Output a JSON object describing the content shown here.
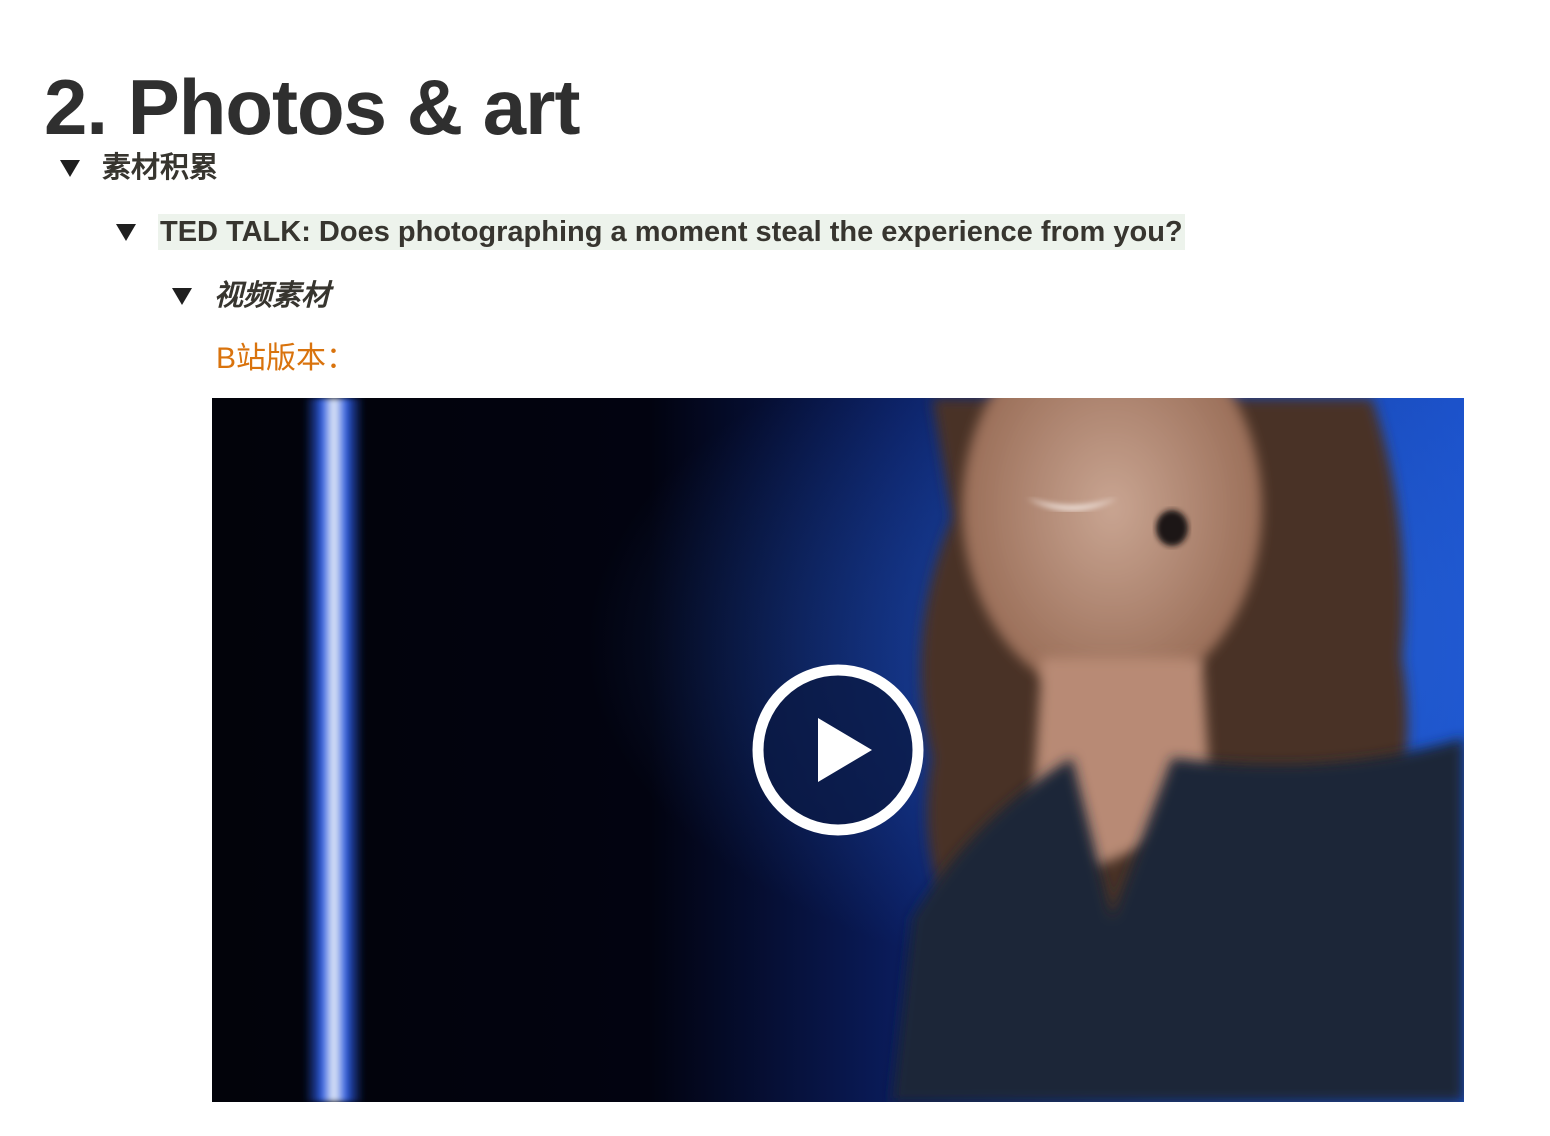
{
  "page": {
    "heading": "2. Photos & art"
  },
  "toggles": [
    {
      "label": "素材积累",
      "expanded": true
    },
    {
      "label": "TED TALK: Does photographing a moment steal the experience from you?",
      "expanded": true,
      "highlight_color": "#edf3ec"
    },
    {
      "label": "视频素材",
      "expanded": true
    }
  ],
  "video_section": {
    "subtitle": "B站版本：",
    "subtitle_color": "#d9730d",
    "play_icon": "play-circle-icon"
  }
}
